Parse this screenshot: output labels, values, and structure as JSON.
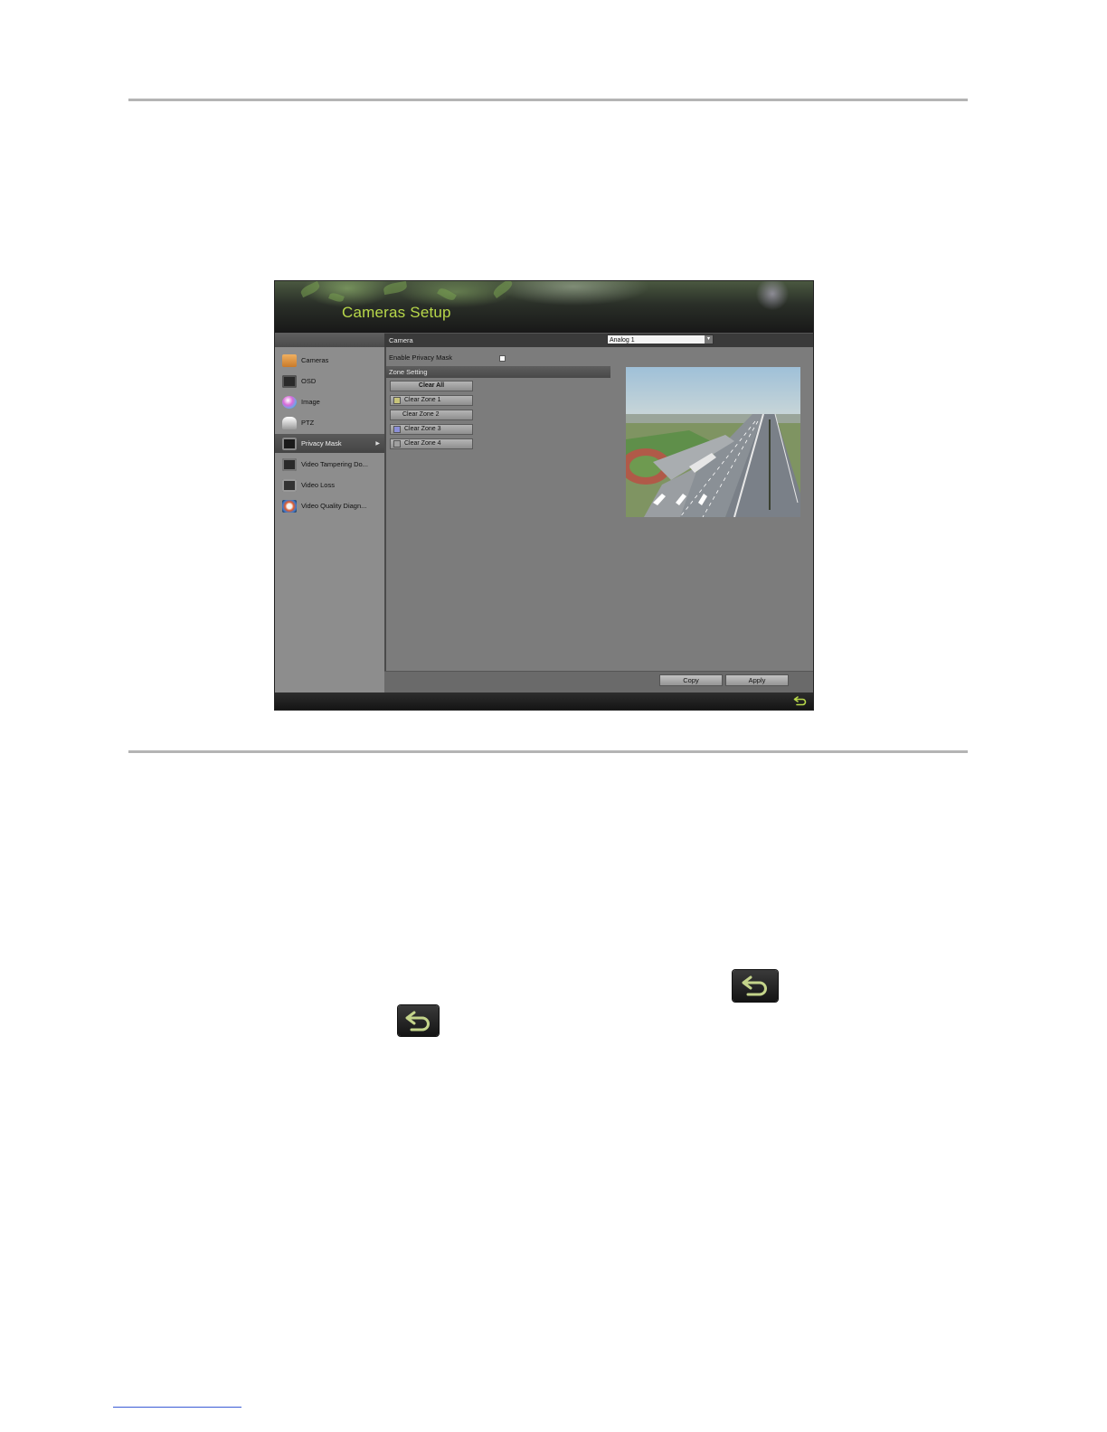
{
  "window": {
    "title": "Cameras Setup"
  },
  "camera_row": {
    "label": "Camera",
    "selected": "Analog 1"
  },
  "sidebar": {
    "items": [
      {
        "label": "Cameras",
        "icon": "camera-folder-icon",
        "active": false
      },
      {
        "label": "OSD",
        "icon": "osd-icon",
        "active": false
      },
      {
        "label": "Image",
        "icon": "image-icon",
        "active": false
      },
      {
        "label": "PTZ",
        "icon": "ptz-icon",
        "active": false
      },
      {
        "label": "Privacy Mask",
        "icon": "privacy-mask-icon",
        "active": true
      },
      {
        "label": "Video Tampering Do...",
        "icon": "video-tampering-icon",
        "active": false
      },
      {
        "label": "Video Loss",
        "icon": "video-loss-icon",
        "active": false
      },
      {
        "label": "Video Quality Diagn...",
        "icon": "video-quality-icon",
        "active": false
      }
    ]
  },
  "privacy": {
    "enable_label": "Enable Privacy Mask",
    "enabled": false,
    "zone_header": "Zone Setting",
    "clear_all": "Clear All",
    "zones": [
      {
        "label": "Clear Zone 1",
        "color": "#c8c47a"
      },
      {
        "label": "Clear Zone 2",
        "color": ""
      },
      {
        "label": "Clear Zone 3",
        "color": "#8b8fd8"
      },
      {
        "label": "Clear Zone 4",
        "color": "#a0a0a0"
      }
    ]
  },
  "footer": {
    "copy": "Copy",
    "apply": "Apply"
  },
  "colors": {
    "title_green": "#b8d84a",
    "panel_gray": "#7c7c7c"
  }
}
